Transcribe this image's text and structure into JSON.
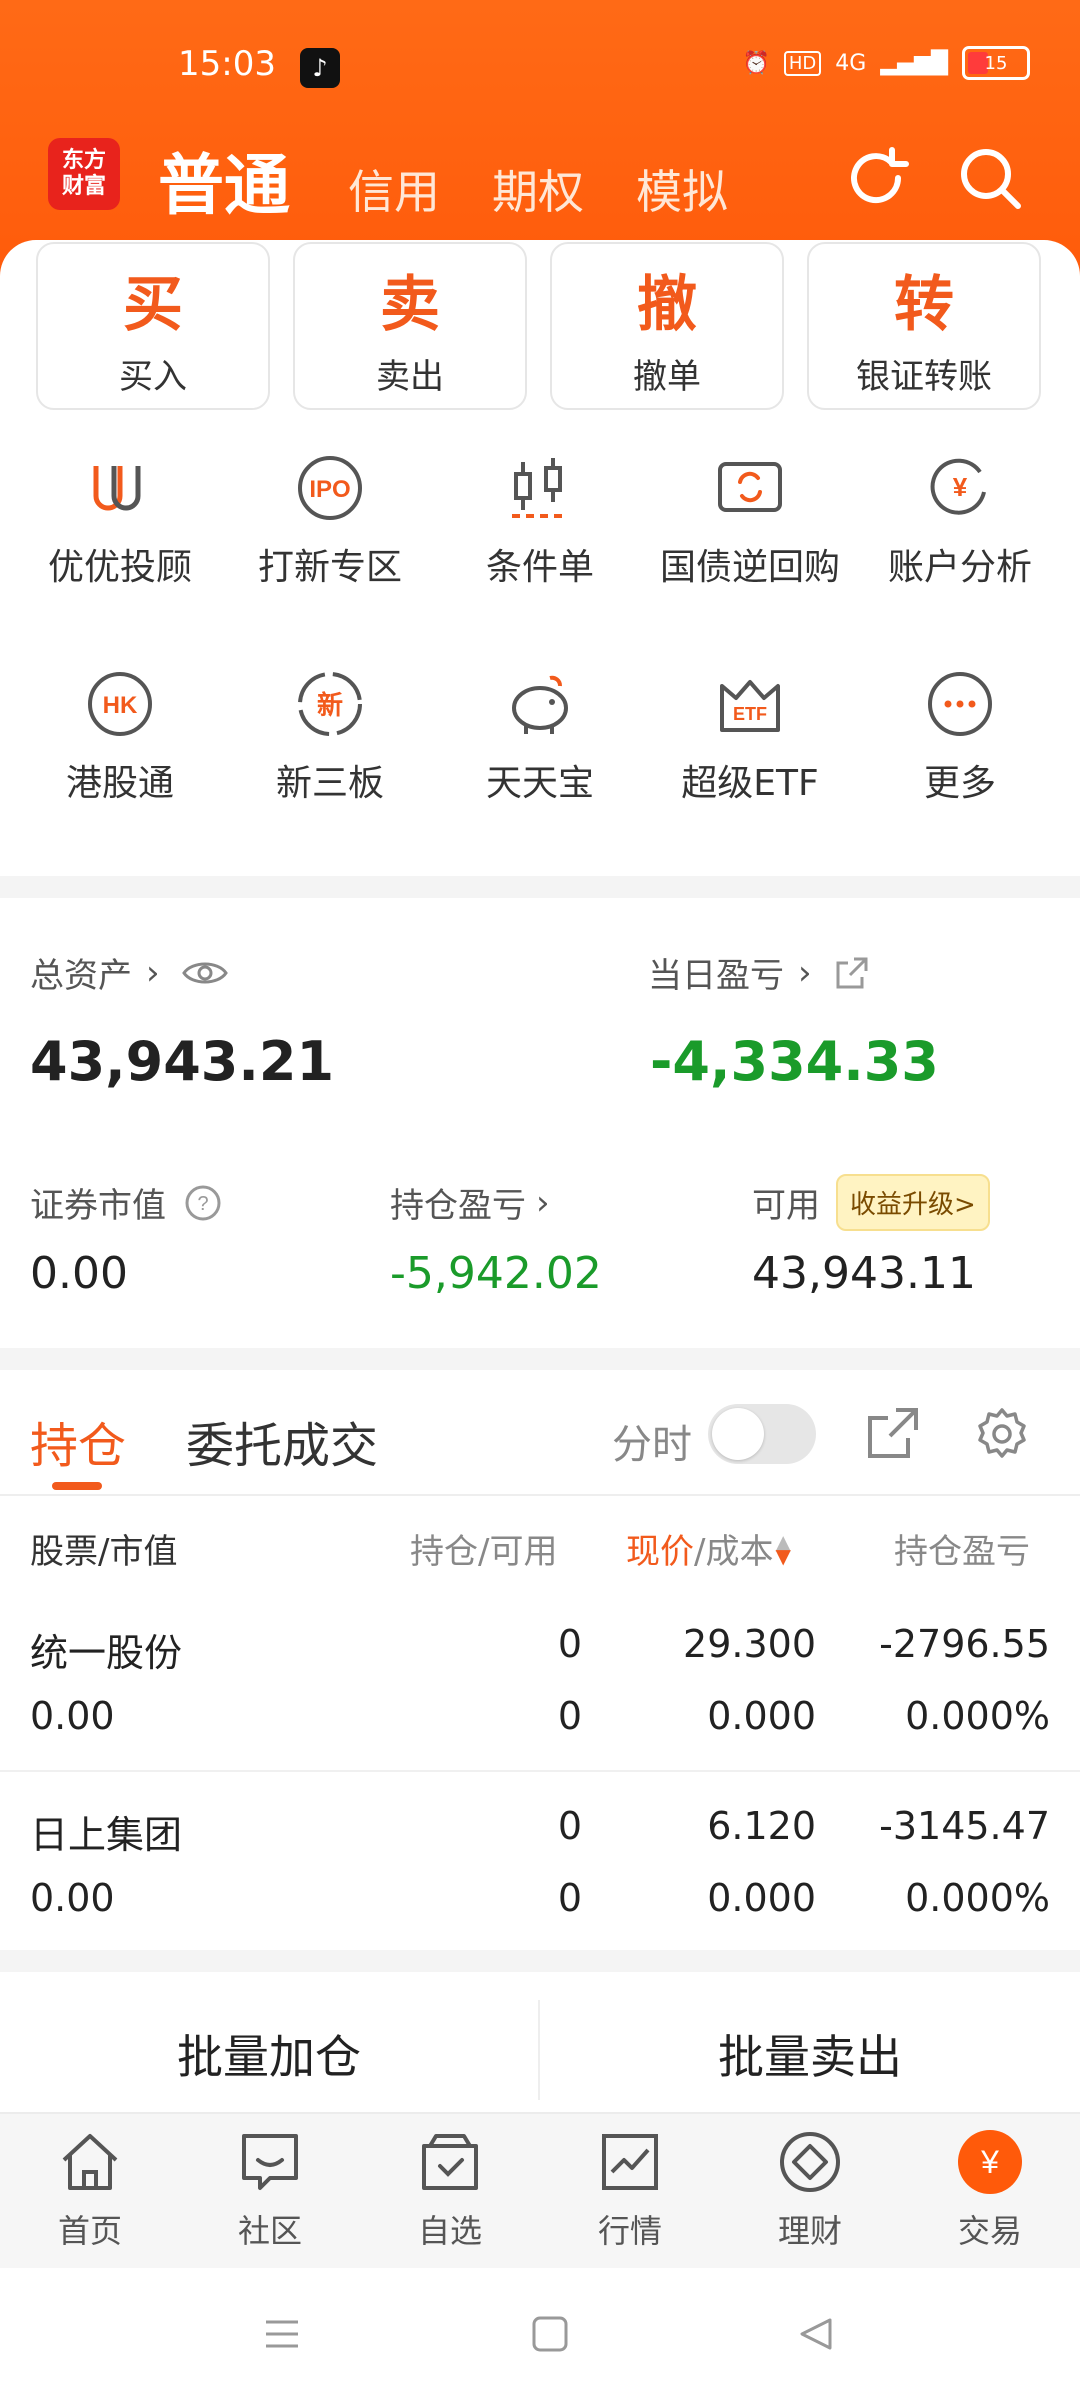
{
  "status": {
    "time": "15:03",
    "battery": "15",
    "network": "4G",
    "hd": "HD"
  },
  "header": {
    "logo": "东方财富",
    "tabs": [
      {
        "label": "普通"
      },
      {
        "label": "信用"
      },
      {
        "label": "期权"
      },
      {
        "label": "模拟"
      }
    ]
  },
  "quick_actions": [
    {
      "big": "买",
      "label": "买入"
    },
    {
      "big": "卖",
      "label": "卖出"
    },
    {
      "big": "撤",
      "label": "撤单"
    },
    {
      "big": "转",
      "label": "银证转账"
    }
  ],
  "grid_row1": [
    {
      "label": "优优投顾",
      "icon": "uu-icon"
    },
    {
      "label": "打新专区",
      "icon": "ipo-icon"
    },
    {
      "label": "条件单",
      "icon": "candlestick-icon"
    },
    {
      "label": "国债逆回购",
      "icon": "bond-repo-icon"
    },
    {
      "label": "账户分析",
      "icon": "account-analysis-icon"
    }
  ],
  "grid_row2": [
    {
      "label": "港股通",
      "icon": "hk-icon"
    },
    {
      "label": "新三板",
      "icon": "new-board-icon"
    },
    {
      "label": "天天宝",
      "icon": "piggy-bank-icon"
    },
    {
      "label": "超级ETF",
      "icon": "etf-crown-icon"
    },
    {
      "label": "更多",
      "icon": "more-icon"
    }
  ],
  "icon_text": {
    "ipo": "IPO",
    "hk": "HK",
    "xin": "新",
    "etf": "ETF",
    "yen": "¥"
  },
  "assets": {
    "total_label": "总资产",
    "total_value": "43,943.21",
    "daily_label": "当日盈亏",
    "daily_value": "-4,334.33",
    "market_label": "证券市值",
    "market_value": "0.00",
    "position_pl_label": "持仓盈亏",
    "position_pl_value": "-5,942.02",
    "available_label": "可用",
    "available_value": "43,943.11",
    "upgrade_badge": "收益升级>"
  },
  "tabs": {
    "holdings": "持仓",
    "orders": "委托成交",
    "timeshare_label": "分时"
  },
  "table": {
    "headers": {
      "stock": "股票/市值",
      "qty": "持仓/可用",
      "price_now": "现价",
      "price_cost": "/成本",
      "pl": "持仓盈亏"
    },
    "rows": [
      {
        "name": "统一股份",
        "value": "0.00",
        "hold": "0",
        "avail": "0",
        "price": "29.300",
        "cost": "0.000",
        "pl": "-2796.55",
        "pct": "0.000%"
      },
      {
        "name": "日上集团",
        "value": "0.00",
        "hold": "0",
        "avail": "0",
        "price": "6.120",
        "cost": "0.000",
        "pl": "-3145.47",
        "pct": "0.000%"
      }
    ]
  },
  "batch": {
    "add": "批量加仓",
    "sell": "批量卖出"
  },
  "bottom_nav": [
    {
      "label": "首页"
    },
    {
      "label": "社区"
    },
    {
      "label": "自选"
    },
    {
      "label": "行情"
    },
    {
      "label": "理财"
    },
    {
      "label": "交易"
    }
  ],
  "nav_badge": "¥",
  "colors": {
    "brand": "#ff5a0a",
    "accent_text": "#f25a1c",
    "loss_green": "#1a9b2a"
  }
}
